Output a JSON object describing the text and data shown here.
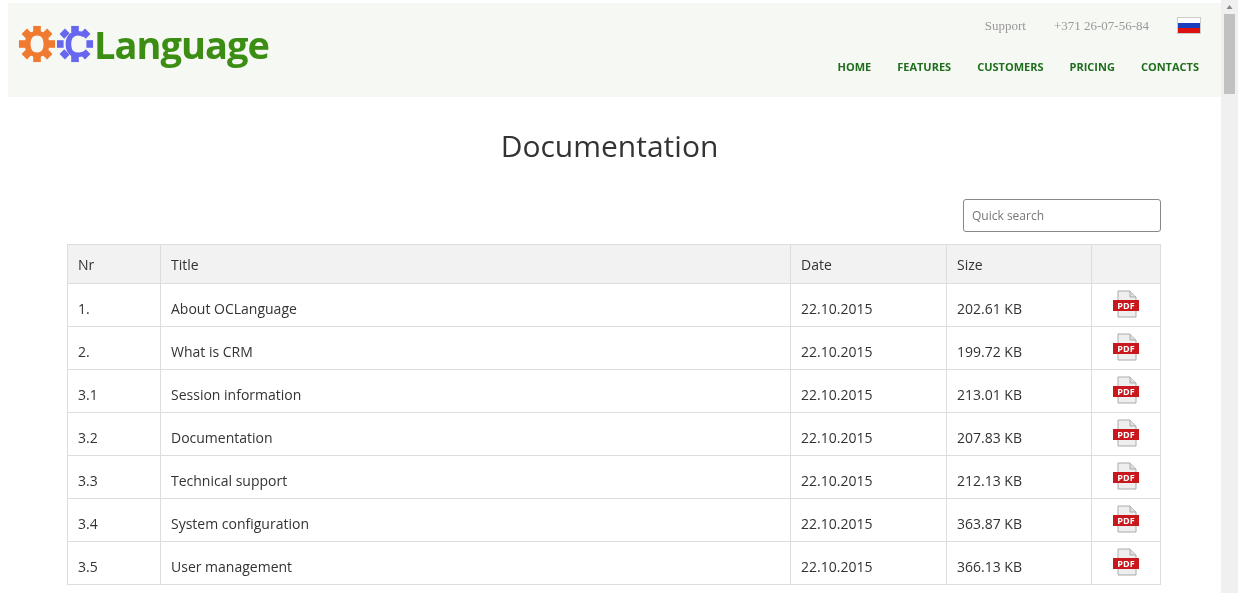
{
  "logo": {
    "gear_letters": [
      "O",
      "C"
    ],
    "text": "Language"
  },
  "top_links": [
    "Support",
    "+371 26-07-56-84"
  ],
  "nav": [
    "HOME",
    "FEATURES",
    "CUSTOMERS",
    "PRICING",
    "CONTACTS"
  ],
  "title": "Documentation",
  "search": {
    "placeholder": "Quick search"
  },
  "table": {
    "columns": [
      "Nr",
      "Title",
      "Date",
      "Size"
    ],
    "rows": [
      {
        "nr": "1.",
        "title": "About OCLanguage",
        "date": "22.10.2015",
        "size": "202.61 KB",
        "file": "PDF"
      },
      {
        "nr": "2.",
        "title": "What is CRM",
        "date": "22.10.2015",
        "size": "199.72 KB",
        "file": "PDF"
      },
      {
        "nr": "3.1",
        "title": "Session information",
        "date": "22.10.2015",
        "size": "213.01 KB",
        "file": "PDF"
      },
      {
        "nr": "3.2",
        "title": "Documentation",
        "date": "22.10.2015",
        "size": "207.83 KB",
        "file": "PDF"
      },
      {
        "nr": "3.3",
        "title": "Technical support",
        "date": "22.10.2015",
        "size": "212.13 KB",
        "file": "PDF"
      },
      {
        "nr": "3.4",
        "title": "System configuration",
        "date": "22.10.2015",
        "size": "363.87 KB",
        "file": "PDF"
      },
      {
        "nr": "3.5",
        "title": "User management",
        "date": "22.10.2015",
        "size": "366.13 KB",
        "file": "PDF"
      }
    ]
  }
}
